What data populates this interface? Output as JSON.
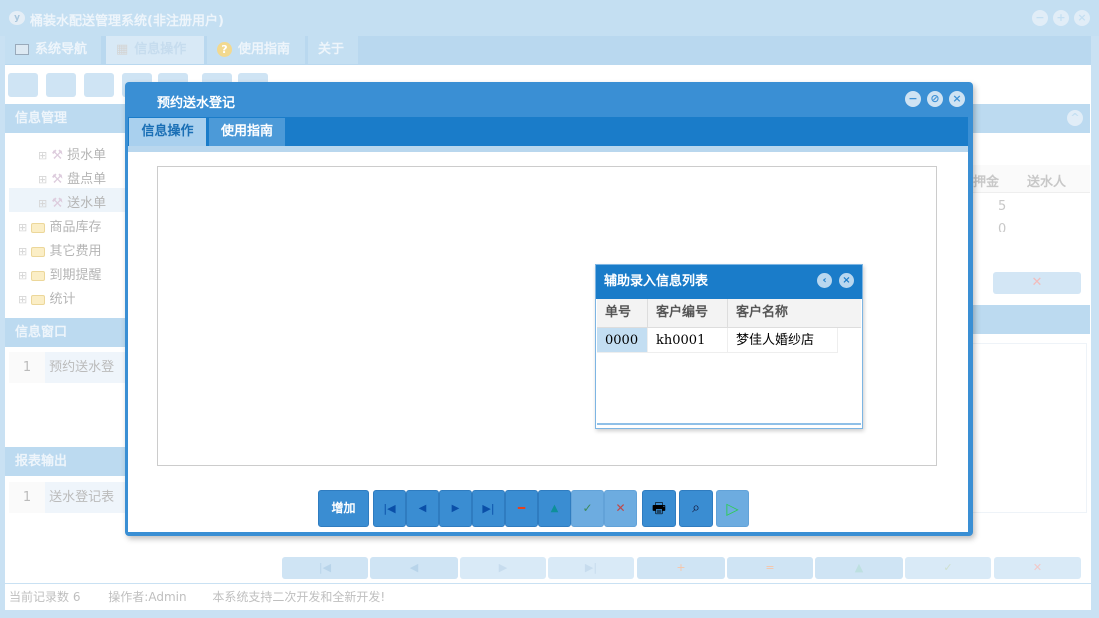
{
  "app": {
    "title": "桶装水配送管理系统(非注册用户)",
    "logo": "y"
  },
  "menu": [
    {
      "label": "系统导航",
      "icon": "monitor-icon"
    },
    {
      "label": "信息操作",
      "icon": "grid-icon",
      "active": true
    },
    {
      "label": "使用指南",
      "icon": "help-icon"
    },
    {
      "label": "关于"
    }
  ],
  "left": {
    "info_mgmt": "信息管理",
    "tree": [
      {
        "label": "损水单",
        "level": 2
      },
      {
        "label": "盘点单",
        "level": 2
      },
      {
        "label": "送水单",
        "level": 2,
        "selected": true
      },
      {
        "label": "商品库存",
        "level": 1
      },
      {
        "label": "其它费用",
        "level": 1
      },
      {
        "label": "到期提醒",
        "level": 1
      },
      {
        "label": "统计",
        "level": 1
      }
    ],
    "info_window": "信息窗口",
    "info_window_rows": [
      {
        "n": "1",
        "label": "预约送水登"
      }
    ],
    "report": "报表输出",
    "report_rows": [
      {
        "n": "1",
        "label": "送水登记表"
      }
    ]
  },
  "right": {
    "columns": [
      "付押金",
      "送水人"
    ],
    "rows": [
      [
        "5",
        ""
      ],
      [
        "0",
        ""
      ]
    ]
  },
  "status": {
    "records": "当前记录数 6",
    "operator": "操作者:Admin",
    "notice": "本系统支持二次开发和全新开发!"
  },
  "modal": {
    "title": "预约送水登记",
    "tabs": [
      {
        "label": "信息操作",
        "active": true
      },
      {
        "label": "使用指南"
      }
    ],
    "buttons": {
      "add": "增加"
    }
  },
  "aux": {
    "title": "辅助录入信息列表",
    "columns": [
      "单号",
      "客户编号",
      "客户名称"
    ],
    "rows": [
      [
        "0000",
        "kh0001",
        "梦佳人婚纱店"
      ]
    ]
  }
}
